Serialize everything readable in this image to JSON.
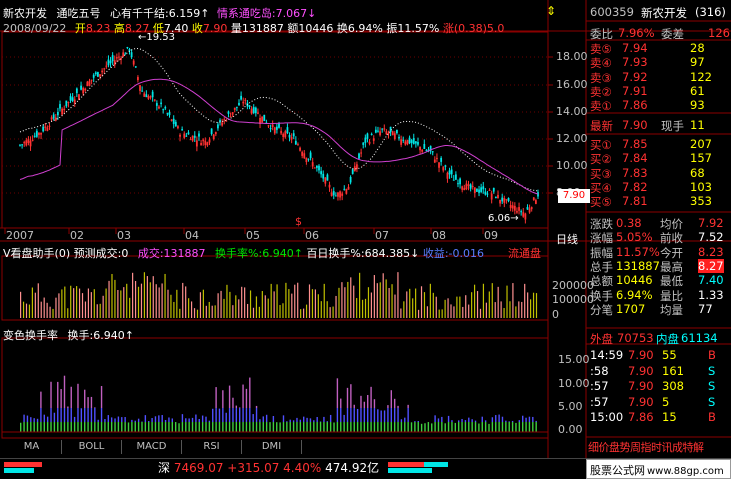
{
  "header": {
    "stock_name": "新农开发",
    "indicator": "通吃五号",
    "xq_label": "心有千千结:",
    "xq_value": "6.159",
    "qj_label": "情系通吃岛:",
    "qj_value": "7.067",
    "date": "2008/09/22",
    "open_label": "开",
    "open": "8.23",
    "high_label": "高",
    "high": "8.27",
    "low_label": "低",
    "low": "7.40",
    "close_label": "收",
    "close": "7.90",
    "volume_label": "量",
    "volume": "131887",
    "amount_label": "额",
    "amount": "10446",
    "turnover_label": "换",
    "turnover": "6.94%",
    "amplitude_label": "振",
    "amplitude": "11.57%",
    "change_label": "涨",
    "change": "(0.38)5.0"
  },
  "price_chart": {
    "y_ticks": [
      "18.00",
      "16.00",
      "14.00",
      "12.00",
      "10.00",
      "8.00"
    ],
    "high_mark": "19.53",
    "low_mark": "6.06",
    "current_tag": "7.90",
    "x_labels": [
      "2007",
      "02",
      "03",
      "04",
      "05",
      "06",
      "07",
      "08",
      "09"
    ],
    "period_label": "日线"
  },
  "vol_panel": {
    "title": "V看盘助手(0)",
    "items": [
      {
        "label": "预测成交:",
        "value": "0"
      },
      {
        "label": "成交:",
        "value": "131887"
      },
      {
        "label": "换手率%:",
        "value": "6.940"
      },
      {
        "label": "百日换手%:",
        "value": "684.385"
      },
      {
        "label": "收益:",
        "value": "-0.016"
      }
    ],
    "tag": "流通盘",
    "y_ticks": [
      "200000",
      "100000",
      "0"
    ]
  },
  "turnover_panel": {
    "title": "变色换手率",
    "item_label": "换手:",
    "item_value": "6.940",
    "y_ticks": [
      "15.00",
      "10.00",
      "5.00",
      "0.00"
    ]
  },
  "bottom_tabs": [
    "MA",
    "BOLL",
    "MACD",
    "RSI",
    "DMI"
  ],
  "status_bar": {
    "market": "深",
    "index": "7469.07",
    "change": "+315.07",
    "pct": "4.40%",
    "amount": "474.92亿"
  },
  "quote_panel": {
    "code": "600359",
    "name": "新农开发",
    "count": "(316)",
    "weibi_label": "委比",
    "weibi": "7.96%",
    "weicha_label": "委差",
    "weicha": "126",
    "asks": [
      {
        "label": "卖⑤",
        "price": "7.94",
        "vol": "28"
      },
      {
        "label": "卖④",
        "price": "7.93",
        "vol": "97"
      },
      {
        "label": "卖③",
        "price": "7.92",
        "vol": "122"
      },
      {
        "label": "卖②",
        "price": "7.91",
        "vol": "61"
      },
      {
        "label": "卖①",
        "price": "7.86",
        "vol": "93"
      }
    ],
    "last_label": "最新",
    "last": "7.90",
    "xianshou_label": "现手",
    "xianshou": "11",
    "bids": [
      {
        "label": "买①",
        "price": "7.85",
        "vol": "207"
      },
      {
        "label": "买②",
        "price": "7.84",
        "vol": "157"
      },
      {
        "label": "买③",
        "price": "7.83",
        "vol": "68"
      },
      {
        "label": "买④",
        "price": "7.82",
        "vol": "103"
      },
      {
        "label": "买⑤",
        "price": "7.81",
        "vol": "353"
      }
    ],
    "stats": [
      {
        "l1": "涨跌",
        "v1": "0.38",
        "l2": "均价",
        "v2": "7.92"
      },
      {
        "l1": "涨幅",
        "v1": "5.05%",
        "l2": "前收",
        "v2": "7.52"
      },
      {
        "l1": "振幅",
        "v1": "11.57%",
        "l2": "今开",
        "v2": "8.23"
      },
      {
        "l1": "总手",
        "v1": "131887",
        "l2": "最高",
        "v2": "8.27"
      },
      {
        "l1": "总额",
        "v1": "10446",
        "l2": "最低",
        "v2": "7.40"
      },
      {
        "l1": "换手",
        "v1": "6.94%",
        "l2": "量比",
        "v2": "1.33"
      },
      {
        "l1": "分笔",
        "v1": "1707",
        "l2": "均量",
        "v2": "77"
      }
    ],
    "outer_label": "外盘",
    "outer": "70753",
    "inner_label": "内盘",
    "inner": "61134",
    "ticks": [
      {
        "time": "14:59",
        "price": "7.90",
        "vol": "55",
        "side": "B"
      },
      {
        "time": ":58",
        "price": "7.90",
        "vol": "161",
        "side": "S"
      },
      {
        "time": ":57",
        "price": "7.90",
        "vol": "308",
        "side": "S"
      },
      {
        "time": ":57",
        "price": "7.90",
        "vol": "5",
        "side": "S"
      },
      {
        "time": "15:00",
        "price": "7.86",
        "vol": "15",
        "side": "B"
      }
    ],
    "bottom_tabs": "细价盘势周指时讯成特解",
    "footer_text": "股票公式网",
    "footer_url": "www.88gp.com"
  },
  "colors": {
    "up": "#ff3232",
    "down": "#00e6e6",
    "grid": "#8b0000",
    "ma_white": "#ffffff",
    "ma_magenta": "#d040d0",
    "bar_green": "#40d040",
    "bar_blue": "#5050ff",
    "bar_purple": "#c060c0"
  }
}
